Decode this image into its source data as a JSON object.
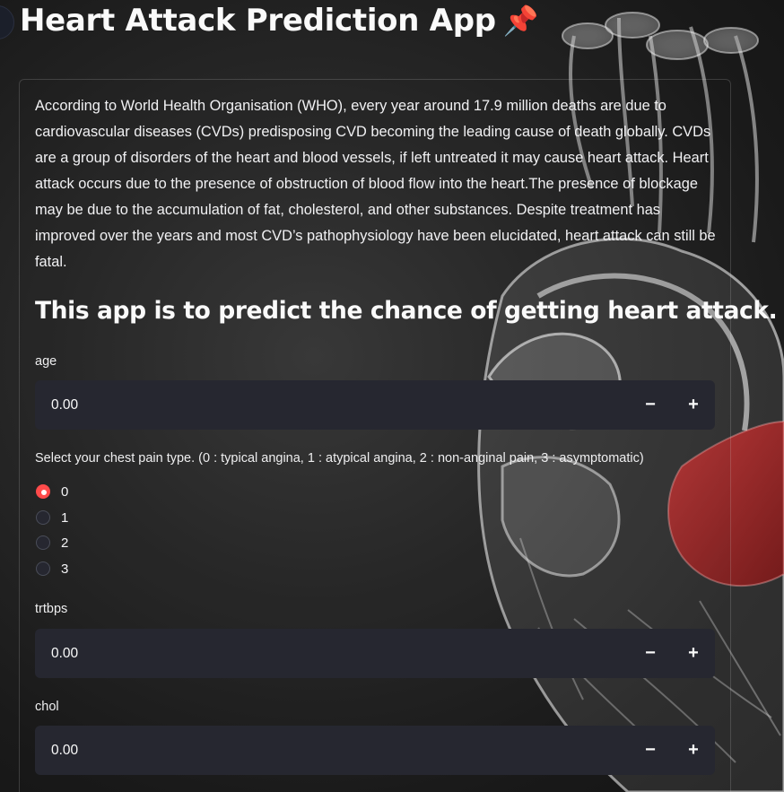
{
  "app": {
    "title": "Heart Attack Prediction App",
    "title_icon": "pushpin-icon",
    "title_icon_glyph": "📌"
  },
  "intro": {
    "text": "According to World Health Organisation (WHO), every year around 17.9 million deaths are due to cardiovascular diseases (CVDs) predisposing CVD becoming the leading cause of death globally. CVDs are a group of disorders of the heart and blood vessels, if left untreated it may cause heart attack. Heart attack occurs due to the presence of obstruction of blood flow into the heart.The presence of blockage may be due to the accumulation of fat, cholesterol, and other substances. Despite treatment has improved over the years and most CVD’s pathophysiology have been elucidated, heart attack can still be fatal."
  },
  "subtitle": "This app is to predict the chance of getting heart attack.",
  "fields": {
    "age": {
      "label": "age",
      "value": "0.00"
    },
    "trtbps": {
      "label": "trtbps",
      "value": "0.00"
    },
    "chol": {
      "label": "chol",
      "value": "0.00"
    }
  },
  "stepper": {
    "minus": "−",
    "plus": "+"
  },
  "chest_pain": {
    "label": "Select your chest pain type. (0 : typical angina, 1 : atypical angina, 2 : non-anginal pain, 3 : asymptomatic)",
    "options": [
      "0",
      "1",
      "2",
      "3"
    ],
    "selected": "0"
  },
  "colors": {
    "accent": "#ff4b4b",
    "input_bg": "#262730",
    "background": "#1e1e1e"
  }
}
